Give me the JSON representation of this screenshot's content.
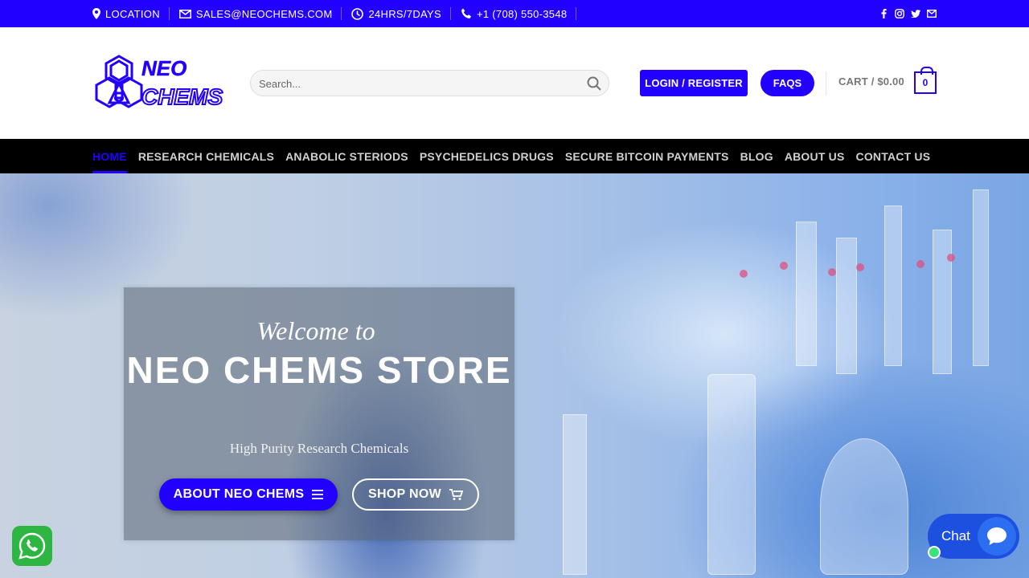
{
  "topbar": {
    "location": "LOCATION",
    "email": "SALES@NEOCHEMS.COM",
    "hours": "24HRS/7DAYS",
    "phone": "+1 (708) 550-3548",
    "social": [
      "facebook-icon",
      "instagram-icon",
      "twitter-icon",
      "mail-icon"
    ]
  },
  "header": {
    "logo_alt": "NEO CHEMS",
    "logo_line1": "NEO",
    "logo_line2": "CHEMS",
    "search_placeholder": "Search...",
    "login_label": "LOGIN / REGISTER",
    "faq_label": "FAQS",
    "cart_label": "CART / $0.00",
    "cart_count": "0"
  },
  "nav": {
    "items": [
      {
        "label": "HOME",
        "active": true
      },
      {
        "label": "RESEARCH CHEMICALS"
      },
      {
        "label": "ANABOLIC STERIODS"
      },
      {
        "label": "PSYCHEDELICS DRUGS"
      },
      {
        "label": "SECURE BITCOIN PAYMENTS"
      },
      {
        "label": "BLOG"
      },
      {
        "label": "ABOUT US"
      },
      {
        "label": "CONTACT US"
      }
    ]
  },
  "hero": {
    "welcome": "Welcome to",
    "title": "NEO CHEMS STORE",
    "subtitle": "High Purity Research Chemicals",
    "about_button": "ABOUT NEO CHEMS",
    "shop_button": "SHOP NOW"
  },
  "chat": {
    "label": "Chat"
  },
  "colors": {
    "brand": "#2200ff",
    "nav_bg": "#000000",
    "whatsapp": "#2db742",
    "chat": "#1e50e0"
  }
}
